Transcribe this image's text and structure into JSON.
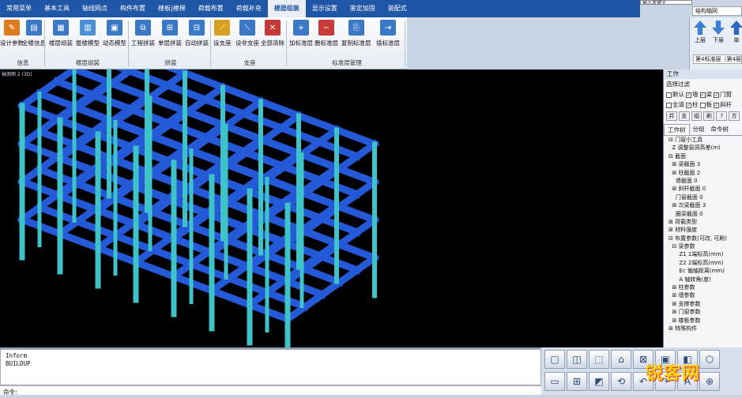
{
  "menubar": [
    "常用菜单",
    "基本工具",
    "轴线网点",
    "构件布置",
    "楼板|楼梯",
    "荷载布置",
    "荷载补充",
    "楼层组装",
    "显示设置",
    "鉴定加固",
    "装配式"
  ],
  "active_menu_index": 7,
  "top_right": {
    "input_text": "输入关键字",
    "grid_label": "结构轴网",
    "up_label": "上层",
    "down_label": "下层",
    "single_label": "单",
    "floor_select": "第4标准层（第4层"
  },
  "ribbon": {
    "buttons": [
      {
        "label": "设计参数",
        "color": "#e07a1f",
        "icon": "✎"
      },
      {
        "label": "全楼信息",
        "color": "#3a78c8",
        "icon": "▤"
      },
      {
        "label": "楼层组装",
        "color": "#3a78c8",
        "icon": "▦"
      },
      {
        "label": "整楼模型",
        "color": "#4a8fd8",
        "icon": "▥"
      },
      {
        "label": "动态模型",
        "color": "#3a78c8",
        "icon": "▣"
      },
      {
        "label": "工程拼装",
        "color": "#3a78c8",
        "icon": "⧉"
      },
      {
        "label": "单层拼装",
        "color": "#3a78c8",
        "icon": "⊞"
      },
      {
        "label": "自动拼装",
        "color": "#3a78c8",
        "icon": "⊟"
      },
      {
        "label": "设支座",
        "color": "#d8a020",
        "icon": "⟋"
      },
      {
        "label": "设非支座",
        "color": "#3a78c8",
        "icon": "⟍"
      },
      {
        "label": "全部清除",
        "color": "#c83a3a",
        "icon": "✕"
      },
      {
        "label": "加标准层",
        "color": "#3a78c8",
        "icon": "+"
      },
      {
        "label": "删标准层",
        "color": "#c83a3a",
        "icon": "−"
      },
      {
        "label": "复制标准层",
        "color": "#3a78c8",
        "icon": "⎘"
      },
      {
        "label": "插标准层",
        "color": "#3a78c8",
        "icon": "⇥"
      }
    ],
    "groups": [
      "信息",
      "楼层组装",
      "拼装",
      "支座",
      "标准层管理"
    ]
  },
  "viewport": {
    "caption": "轴测图 2 (3D)"
  },
  "right_panel": {
    "title": "工作",
    "filter_label": "选择过滤",
    "filters_row1": [
      {
        "t": "默认",
        "on": false
      },
      {
        "t": "墙",
        "on": true
      },
      {
        "t": "梁",
        "on": true
      },
      {
        "t": "门窗",
        "on": true
      }
    ],
    "filters_row2": [
      {
        "t": "全清",
        "on": false
      },
      {
        "t": "柱",
        "on": true
      },
      {
        "t": "板",
        "on": false
      },
      {
        "t": "斜杆",
        "on": true
      }
    ],
    "buttons": [
      "井",
      "支",
      "组",
      "刷",
      "?",
      "方"
    ],
    "tabs": [
      "工作树",
      "分组",
      "命令树"
    ],
    "tree": [
      "⊟ 门窗小工具",
      "  Z 调整窗洞高差(m)",
      "⊟ 截面",
      "  ⊞ 梁截面 3",
      "  ⊞ 柱截面 2",
      "    墙截面 0",
      "  ⊞ 斜杆截面 0",
      "    门窗截面 0",
      "  ⊞ 次梁截面 3",
      "    圈梁截面 0",
      "⊞ 荷载类型",
      "⊞ 材料强度",
      "⊟ 布置参数(可改, 可刷)",
      "  ⊟ 梁参数",
      "      Z1 1端标高(mm)",
      "      Z2 2端标高(mm)",
      "      Ec 偏轴距离(mm)",
      "      A 轴转角(度)",
      "  ⊞ 柱参数",
      "  ⊞ 墙参数",
      "  ⊞ 支撑参数",
      "  ⊞ 门窗参数",
      "  ⊞ 楼板参数",
      "⊞ 特殊构件"
    ]
  },
  "command": {
    "log": [
      "Inform",
      "BUILDUP"
    ],
    "prompt": "命令:"
  },
  "bottom_toolbar": [
    "▢",
    "◫",
    "⬚",
    "⌂",
    "⊠",
    "▣",
    "◧",
    "⬡",
    "▭",
    "⊞",
    "◩",
    "⟲",
    "↶",
    "↷",
    "A",
    "⊕"
  ],
  "watermark": "锐客网",
  "colors": {
    "beam": "#2459d8",
    "column": "#3ec3c8",
    "menubar": "#1f56a8",
    "background": "#000000"
  }
}
